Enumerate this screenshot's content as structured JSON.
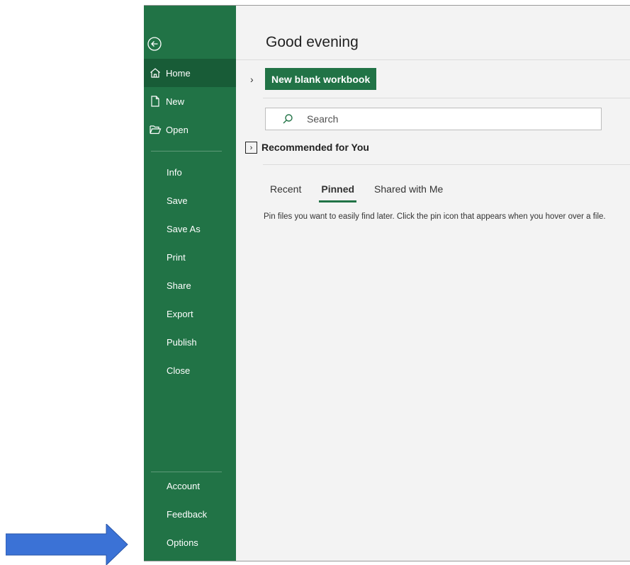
{
  "colors": {
    "sidebar": "#217346",
    "sidebar_active": "#185c37",
    "arrow": "#3b72d6"
  },
  "sidebar": {
    "back_icon": "back-arrow-circle-icon",
    "top_items": [
      {
        "label": "Home",
        "icon": "home-icon",
        "active": true
      },
      {
        "label": "New",
        "icon": "new-document-icon"
      },
      {
        "label": "Open",
        "icon": "folder-open-icon"
      }
    ],
    "middle_items": [
      "Info",
      "Save",
      "Save As",
      "Print",
      "Share",
      "Export",
      "Publish",
      "Close"
    ],
    "bottom_items": [
      "Account",
      "Feedback",
      "Options"
    ]
  },
  "main": {
    "greeting": "Good evening",
    "new_blank_label": "New blank workbook",
    "search": {
      "placeholder": "Search",
      "icon": "search-icon"
    },
    "recommended_title": "Recommended for You",
    "tabs": [
      {
        "label": "Recent"
      },
      {
        "label": "Pinned",
        "active": true
      },
      {
        "label": "Shared with Me"
      }
    ],
    "pinned_message": "Pin files you want to easily find later. Click the pin icon that appears when you hover over a file."
  }
}
